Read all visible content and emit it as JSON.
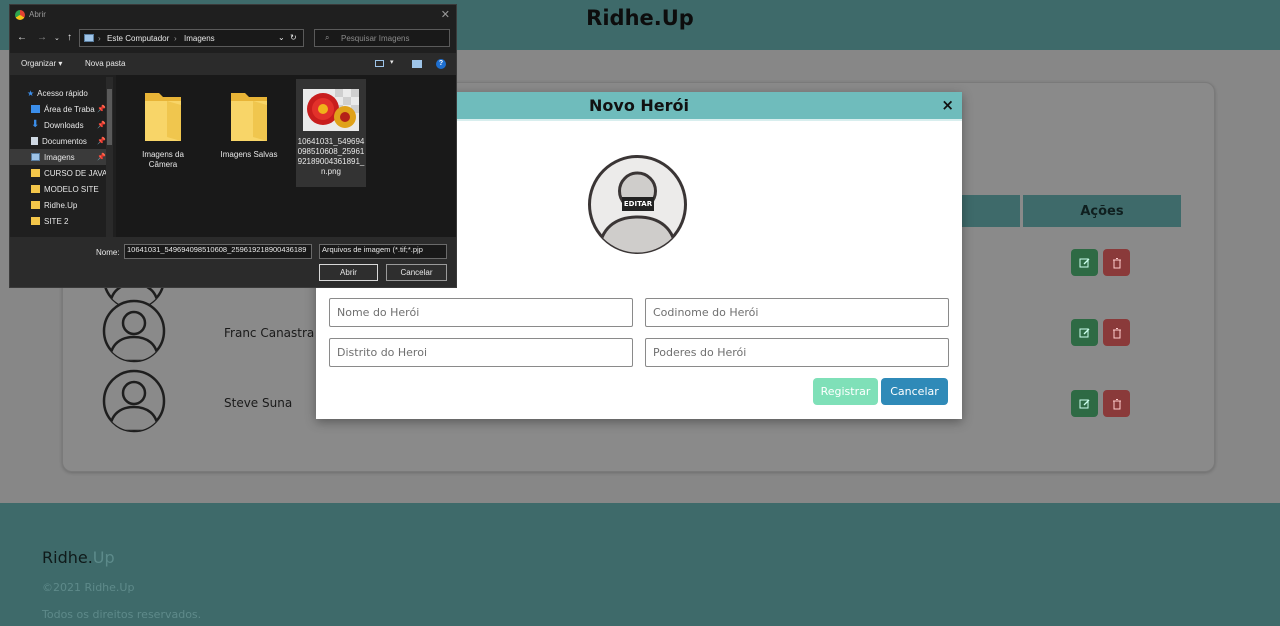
{
  "page": {
    "brand": "Ridhe.Up",
    "table_headers": {
      "actions": "Ações"
    },
    "heroes": [
      {
        "name": "Franc Canastra"
      },
      {
        "name": "Steve Suna"
      }
    ],
    "footer": {
      "brand_main": "Ridhe.",
      "brand_accent": "Up",
      "copyright": "©2021 Ridhe.Up",
      "rights": "Todos os direitos reservados."
    }
  },
  "modal": {
    "title": "Novo Herói",
    "close": "×",
    "edit_tag": "EDITAR",
    "fields": {
      "name_placeholder": "Nome do Herói",
      "codename_placeholder": "Codinome do Herói",
      "district_placeholder": "Distrito do Heroi",
      "powers_placeholder": "Poderes do Herói"
    },
    "buttons": {
      "register": "Registrar",
      "cancel": "Cancelar"
    }
  },
  "file_dialog": {
    "title": "Abrir",
    "close": "✕",
    "breadcrumb": [
      "Este Computador",
      "Imagens"
    ],
    "search_placeholder": "Pesquisar Imagens",
    "toolbar": {
      "organize": "Organizar ▾",
      "new_folder": "Nova pasta"
    },
    "nav_items": [
      {
        "label": "Acesso rápido",
        "icon": "star-icon",
        "color": "#3b8eea"
      },
      {
        "label": "Área de Traba",
        "icon": "desktop-icon",
        "color": "#3b8eea",
        "pin": true
      },
      {
        "label": "Downloads",
        "icon": "download-icon",
        "color": "#3b8eea",
        "pin": true
      },
      {
        "label": "Documentos",
        "icon": "document-icon",
        "color": "#cfd8e3",
        "pin": true
      },
      {
        "label": "Imagens",
        "icon": "image-icon",
        "color": "#9ec4e8",
        "pin": true,
        "selected": true
      },
      {
        "label": "CURSO DE JAVAS",
        "icon": "folder-icon",
        "color": "#f3c64a"
      },
      {
        "label": "MODELO SITE",
        "icon": "folder-icon",
        "color": "#f3c64a"
      },
      {
        "label": "Ridhe.Up",
        "icon": "folder-icon",
        "color": "#f3c64a"
      },
      {
        "label": "SITE 2",
        "icon": "folder-icon",
        "color": "#f3c64a"
      }
    ],
    "files": [
      {
        "lines": [
          "Imagens da",
          "Câmera"
        ],
        "type": "folder"
      },
      {
        "lines": [
          "Imagens Salvas"
        ],
        "type": "folder"
      },
      {
        "lines": [
          "10641031_549694",
          "098510608_25961",
          "92189004361891_",
          "n.png"
        ],
        "type": "image",
        "selected": true
      }
    ],
    "name_label": "Nome:",
    "name_value": "10641031_549694098510608_259619218900436189",
    "filetype": "Arquivos de imagem (*.tif;*.pjp",
    "open_button": "Abrir",
    "cancel_button": "Cancelar"
  }
}
